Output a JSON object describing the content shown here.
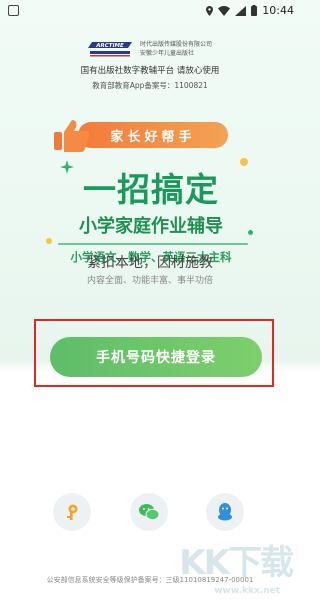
{
  "status_bar": {
    "time": "10:44",
    "icons": [
      "app-icon",
      "location-icon",
      "wifi-icon",
      "signal-icon",
      "battery-icon"
    ]
  },
  "publisher": {
    "logo_text": "ARCTIME",
    "company_line1": "时代出版传媒股份有限公司",
    "company_line2": "安徽少年儿童出版社",
    "tagline": "国有出版社数字教辅平台  请放心使用",
    "record": "教育部教育App备案号：1100821"
  },
  "banner": {
    "pill_text": "家长好帮手",
    "headline": "一招搞定",
    "subtitle": "小学家庭作业辅导",
    "subjects": "小学语文、数学、英语三大主科"
  },
  "slogan": {
    "main": "紧扣本地，因材施教",
    "sub": "内容全面、功能丰富、事半功倍"
  },
  "login": {
    "button_label": "手机号码快捷登录",
    "alt_methods": [
      "key-icon",
      "wechat-icon",
      "qq-icon"
    ]
  },
  "footer": {
    "text": "公安部信息系统安全等级保护备案号：三级11010819247-00001"
  },
  "watermark": {
    "text": "KK下载",
    "url": "www.kkx.net"
  },
  "colors": {
    "brand_green": "#1a9a5a",
    "button_green": "#5ebd69",
    "pill_orange": "#f57a3a",
    "highlight_red": "#e02a2a"
  }
}
